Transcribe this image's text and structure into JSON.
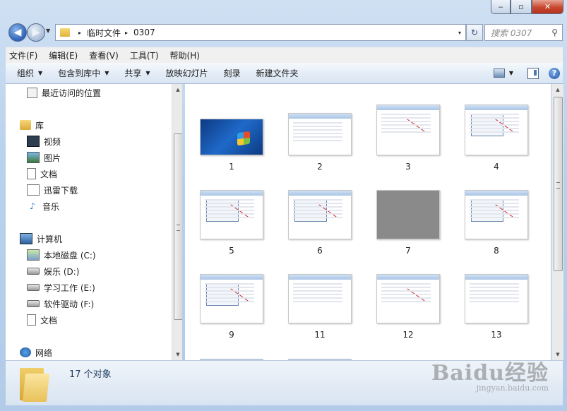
{
  "window": {
    "captions": {
      "minimize": "‒",
      "maximize": "▫",
      "close": "✕"
    }
  },
  "address": {
    "path": [
      "临时文件",
      "0307"
    ],
    "separator": "▸",
    "drop": "▾",
    "refresh": "↻"
  },
  "search": {
    "placeholder": "搜索 0307",
    "icon": "search-icon"
  },
  "menubar": [
    "文件(F)",
    "编辑(E)",
    "查看(V)",
    "工具(T)",
    "帮助(H)"
  ],
  "commandbar": {
    "items": [
      {
        "label": "组织",
        "dropdown": true
      },
      {
        "label": "包含到库中",
        "dropdown": true
      },
      {
        "label": "共享",
        "dropdown": true
      },
      {
        "label": "放映幻灯片",
        "dropdown": false
      },
      {
        "label": "刻录",
        "dropdown": false
      },
      {
        "label": "新建文件夹",
        "dropdown": false
      }
    ],
    "dropdown_glyph": "▼",
    "help": "?"
  },
  "navpane": {
    "recent": "最近访问的位置",
    "libraries": "库",
    "library_items": [
      "视频",
      "图片",
      "文档",
      "迅雷下载",
      "音乐"
    ],
    "computer": "计算机",
    "drives": [
      "本地磁盘 (C:)",
      "娱乐 (D:)",
      "学习工作 (E:)",
      "软件驱动 (F:)",
      "文档"
    ],
    "network": "网络"
  },
  "scroll": {
    "up": "▲",
    "down": "▼"
  },
  "files": [
    "1",
    "2",
    "3",
    "4",
    "5",
    "6",
    "7",
    "8",
    "9",
    "11",
    "12",
    "13"
  ],
  "details": {
    "count": "17 个对象"
  },
  "watermark": {
    "brand": "Baidu经验",
    "url": "jingyan.baidu.com"
  }
}
